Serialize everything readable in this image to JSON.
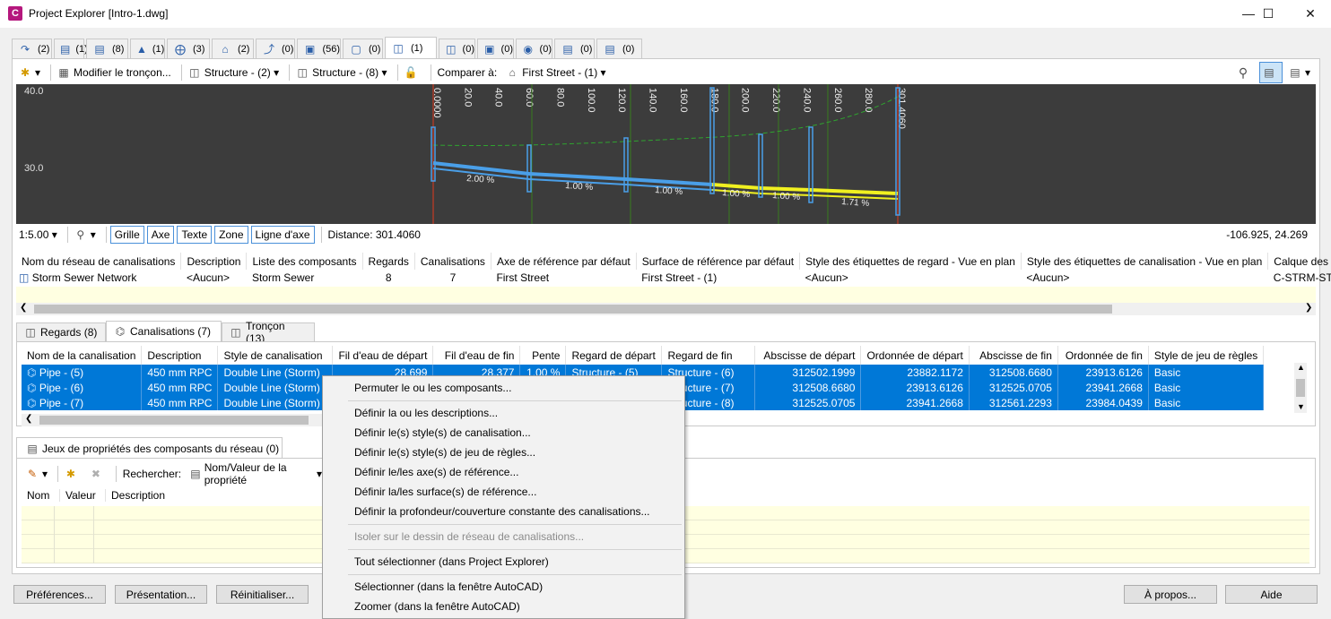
{
  "window": {
    "title": "Project Explorer [Intro-1.dwg]",
    "app_icon_letter": "C"
  },
  "top_tabs": [
    {
      "icon": "alignment-icon",
      "count": "(2)"
    },
    {
      "icon": "sites-icon",
      "count": "(1)"
    },
    {
      "icon": "profiles-icon",
      "count": "(8)"
    },
    {
      "icon": "corridor-icon",
      "count": "(1)"
    },
    {
      "icon": "sample-lines-icon",
      "count": "(3)"
    },
    {
      "icon": "surfaces-icon",
      "count": "(2)"
    },
    {
      "icon": "feature-lines-icon",
      "count": "(0)"
    },
    {
      "icon": "parcels-icon",
      "count": "(56)"
    },
    {
      "icon": "point-groups-icon",
      "count": "(0)"
    },
    {
      "icon": "pipe-networks-icon",
      "count": "(1)"
    },
    {
      "icon": "pressure-networks-icon",
      "count": "(0)"
    },
    {
      "icon": "assemblies-icon",
      "count": "(0)"
    },
    {
      "icon": "intersections-icon",
      "count": "(0)"
    },
    {
      "icon": "catchments-icon",
      "count": "(0)"
    },
    {
      "icon": "data-shortcuts-icon",
      "count": "(0)"
    }
  ],
  "toolbar": {
    "edit_label": "Modifier le tronçon...",
    "structure1": "Structure - (2)",
    "structure2": "Structure - (8)",
    "compare_label": "Comparer à:",
    "compare_value": "First Street - (1)"
  },
  "profile": {
    "y_labels": [
      "40.0",
      "30.0"
    ],
    "stations": [
      "0.0000",
      "20.0",
      "40.0",
      "60.0",
      "80.0",
      "100.0",
      "120.0",
      "140.0",
      "160.0",
      "180.0",
      "200.0",
      "220.0",
      "240.0",
      "260.0",
      "280.0",
      "301.4060"
    ],
    "slopes": [
      "2.00 %",
      "1.00 %",
      "1.00 %",
      "1.00 %",
      "1.00 %",
      "1.71 %"
    ]
  },
  "profile_status": {
    "zoom": "1:5.00",
    "buttons": [
      "Grille",
      "Axe",
      "Texte",
      "Zone",
      "Ligne d'axe"
    ],
    "distance": "Distance: 301.4060",
    "coords": "-106.925, 24.269"
  },
  "network_table": {
    "headers": [
      "Nom du réseau de canalisations",
      "Description",
      "Liste des composants",
      "Regards",
      "Canalisations",
      "Axe de référence par défaut",
      "Surface de référence par défaut",
      "Style des étiquettes de regard - Vue en plan",
      "Style des étiquettes de canalisation - Vue en plan",
      "Calque des regards -"
    ],
    "row": [
      "Storm Sewer Network",
      "<Aucun>",
      "Storm Sewer",
      "8",
      "7",
      "First Street",
      "First Street - (1)",
      "<Aucun>",
      "<Aucun>",
      "C-STRM-STRC"
    ]
  },
  "sub_tabs": [
    "Regards (8)",
    "Canalisations (7)",
    "Tronçon (13)"
  ],
  "pipe_table": {
    "headers": [
      "Nom de la canalisation",
      "Description",
      "Style de canalisation",
      "Fil d'eau de départ",
      "Fil d'eau de fin",
      "Pente",
      "Regard de départ",
      "Regard de fin",
      "Abscisse de départ",
      "Ordonnée de départ",
      "Abscisse de fin",
      "Ordonnée de fin",
      "Style de jeu de règles"
    ],
    "rows": [
      [
        "Pipe - (5)",
        "450 mm RPC",
        "Double Line (Storm)",
        "28.699",
        "28.377",
        "1.00 %",
        "Structure - (5)",
        "Structure - (6)",
        "312502.1999",
        "23882.1172",
        "312508.6680",
        "23913.6126",
        "Basic"
      ],
      [
        "Pipe - (6)",
        "450 mm RPC",
        "Double Line (Storm)",
        "",
        "",
        "",
        "",
        "Structure - (7)",
        "312508.6680",
        "23913.6126",
        "312525.0705",
        "23941.2668",
        "Basic"
      ],
      [
        "Pipe - (7)",
        "450 mm RPC",
        "Double Line (Storm)",
        "",
        "",
        "",
        "",
        "Structure - (8)",
        "312525.0705",
        "23941.2668",
        "312561.2293",
        "23984.0439",
        "Basic"
      ]
    ]
  },
  "property_panel": {
    "tab_label": "Jeux de propriétés des composants du réseau (0)",
    "search_label": "Rechercher:",
    "search_value": "Nom/Valeur de la propriété",
    "headers": [
      "Nom",
      "Valeur",
      "Description"
    ]
  },
  "context_menu": {
    "items": [
      "Permuter le ou les composants...",
      "Définir la ou les descriptions...",
      "Définir le(s) style(s) de canalisation...",
      "Définir le(s) style(s) de jeu de règles...",
      "Définir le/les axe(s) de référence...",
      "Définir la/les surface(s) de référence...",
      "Définir la profondeur/couverture constante des canalisations...",
      "Isoler sur le dessin de réseau de canalisations...",
      "Tout sélectionner (dans Project Explorer)",
      "Sélectionner (dans la fenêtre AutoCAD)",
      "Zoomer (dans la fenêtre AutoCAD)"
    ]
  },
  "bottom_buttons": {
    "prefs": "Préférences...",
    "presentation": "Présentation...",
    "reset": "Réinitialiser...",
    "about": "À propos...",
    "help": "Aide"
  }
}
